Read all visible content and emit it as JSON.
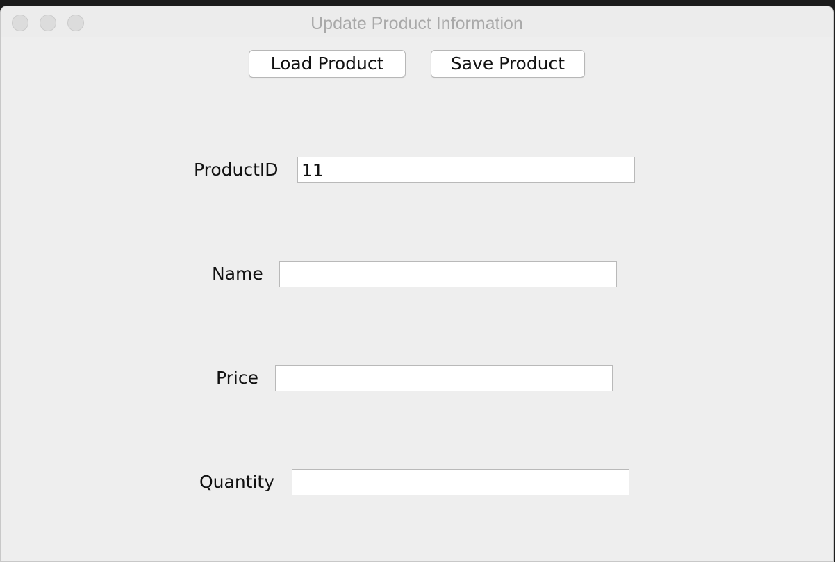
{
  "window": {
    "title": "Update Product Information"
  },
  "toolbar": {
    "load_label": "Load Product",
    "save_label": "Save Product"
  },
  "form": {
    "product_id": {
      "label": "ProductID",
      "value": "11"
    },
    "name": {
      "label": "Name",
      "value": ""
    },
    "price": {
      "label": "Price",
      "value": ""
    },
    "quantity": {
      "label": "Quantity",
      "value": ""
    }
  }
}
